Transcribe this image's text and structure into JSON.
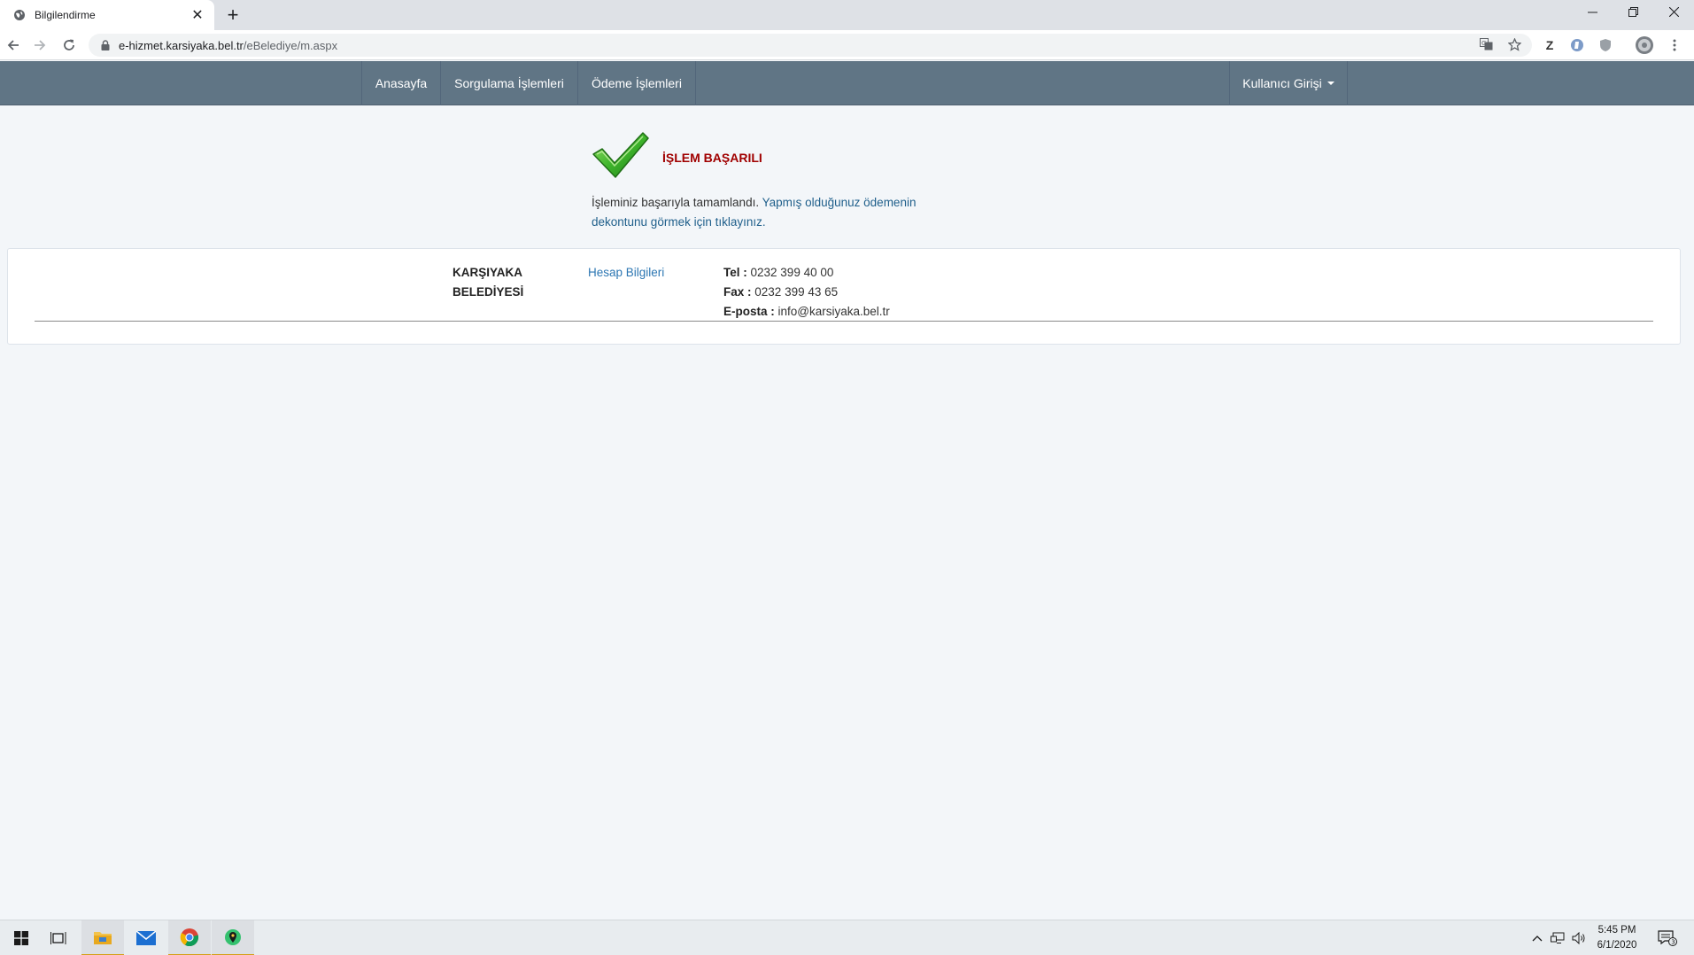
{
  "browser": {
    "tab_title": "Bilgilendirme",
    "url_host": "e-hizmet.karsiyaka.bel.tr",
    "url_path": "/eBelediye/m.aspx",
    "extension_z_label": "Z"
  },
  "nav": {
    "items": [
      {
        "label": "Anasayfa"
      },
      {
        "label": "Sorgulama İşlemleri"
      },
      {
        "label": "Ödeme İşlemleri"
      }
    ],
    "user_menu_label": "Kullanıcı Girişi"
  },
  "success": {
    "title": "İŞLEM BAŞARILI",
    "message_prefix": "İşleminiz başarıyla tamamlandı. ",
    "message_link": "Yapmış olduğunuz ödemenin dekontunu görmek için tıklayınız."
  },
  "footer": {
    "org_name": "KARŞIYAKA BELEDİYESİ",
    "account_link": "Hesap Bilgileri",
    "tel_label": "Tel :",
    "tel_value": "0232 399 40 00",
    "fax_label": "Fax :",
    "fax_value": "0232 399 43 65",
    "email_label": "E-posta :",
    "email_value": "info@karsiyaka.bel.tr"
  },
  "taskbar": {
    "time": "5:45 PM",
    "date": "6/1/2020",
    "notification_count": "3"
  },
  "colors": {
    "navbar": "#607585",
    "success_title": "#a00000",
    "link": "#2d77b3",
    "page_bg": "#f3f6f9"
  }
}
